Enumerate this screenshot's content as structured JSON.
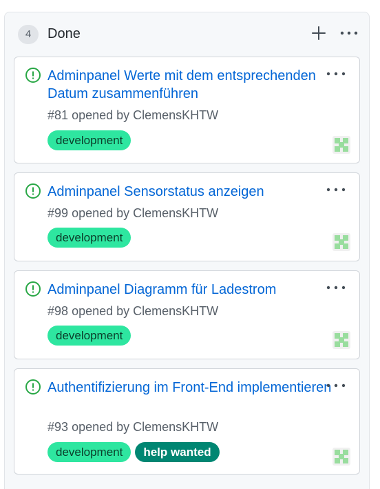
{
  "column": {
    "count": "4",
    "title": "Done",
    "add_icon": "plus-icon",
    "menu_icon": "kebab-horizontal-icon"
  },
  "colors": {
    "link": "#0366d6",
    "open_issue": "#28a745",
    "label_development": "#2ee6a0",
    "label_help_wanted": "#008672"
  },
  "cards": [
    {
      "title": "Adminpanel Werte mit dem entsprechenden Datum zusammenführen",
      "number": "#81",
      "opened_by": "opened by",
      "author": "ClemensKHTW",
      "labels": [
        "development"
      ]
    },
    {
      "title": "Adminpanel Sensorstatus anzeigen",
      "number": "#99",
      "opened_by": "opened by",
      "author": "ClemensKHTW",
      "labels": [
        "development"
      ]
    },
    {
      "title": "Adminpanel Diagramm für Ladestrom",
      "number": "#98",
      "opened_by": "opened by",
      "author": "ClemensKHTW",
      "labels": [
        "development"
      ]
    },
    {
      "title": "Authentifizierung im Front-End implementieren",
      "number": "#93",
      "opened_by": "opened by",
      "author": "ClemensKHTW",
      "labels": [
        "development",
        "help wanted"
      ]
    }
  ]
}
